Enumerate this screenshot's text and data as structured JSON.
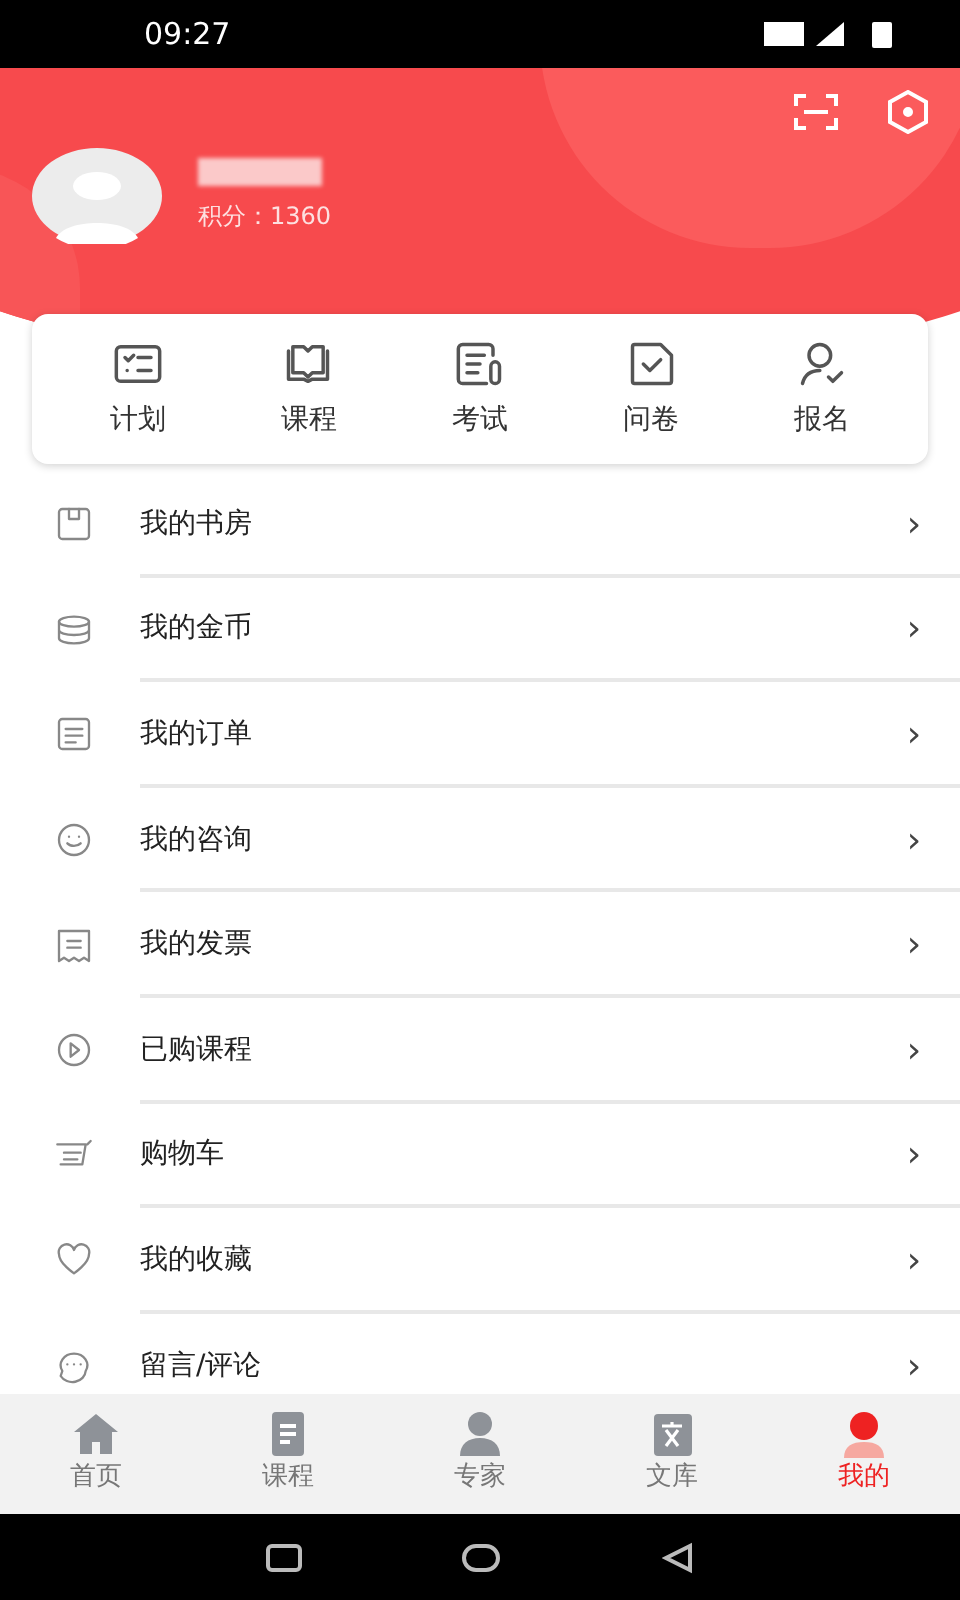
{
  "status_bar": {
    "time": "09:27"
  },
  "profile": {
    "points": "积分：1360"
  },
  "shortcuts": [
    {
      "label": "计划",
      "kind": "plan"
    },
    {
      "label": "课程",
      "kind": "book"
    },
    {
      "label": "考试",
      "kind": "exam"
    },
    {
      "label": "问卷",
      "kind": "survey"
    },
    {
      "label": "报名",
      "kind": "signup"
    }
  ],
  "menu": [
    {
      "label": "我的书房",
      "kind": "study"
    },
    {
      "label": "我的金币",
      "kind": "coins"
    },
    {
      "label": "我的订单",
      "kind": "order"
    },
    {
      "label": "我的咨询",
      "kind": "consult"
    },
    {
      "label": "我的发票",
      "kind": "invoice"
    },
    {
      "label": "已购课程",
      "kind": "play"
    },
    {
      "label": "购物车",
      "kind": "cart"
    },
    {
      "label": "我的收藏",
      "kind": "heart"
    },
    {
      "label": "留言/评论",
      "kind": "comment"
    }
  ],
  "chevron": "›",
  "tab_bar": [
    {
      "label": "首页",
      "kind": "home",
      "selected": false
    },
    {
      "label": "课程",
      "kind": "course",
      "selected": false
    },
    {
      "label": "专家",
      "kind": "expert",
      "selected": false
    },
    {
      "label": "文库",
      "kind": "library",
      "selected": false
    },
    {
      "label": "我的",
      "kind": "me",
      "selected": true
    }
  ]
}
